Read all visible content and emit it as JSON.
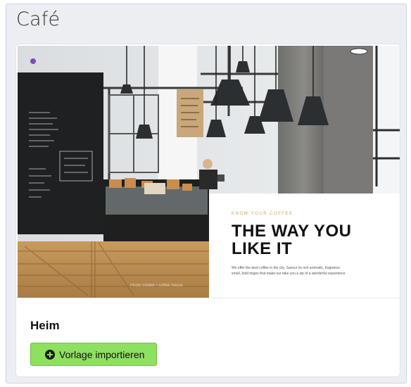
{
  "section": {
    "title": "Café"
  },
  "template": {
    "name": "Heim",
    "import_button_label": "Vorlage importieren",
    "preview": {
      "eyebrow": "KNOW YOUR COFFEE",
      "hero_title_line1": "THE WAY YOU",
      "hero_title_line2": "LIKE IT",
      "body_line1": "We offer the best coffee in the city. Savour its rich aromatic, fragrance",
      "body_line2": "smell, bold tinges that make our take you a sip of a wonderful experience",
      "photo_caption": "Photo credits • coffee house"
    }
  },
  "colors": {
    "accent_green": "#8de060",
    "panel_bg": "#edeef2",
    "panel_border": "#c9d4e6"
  }
}
